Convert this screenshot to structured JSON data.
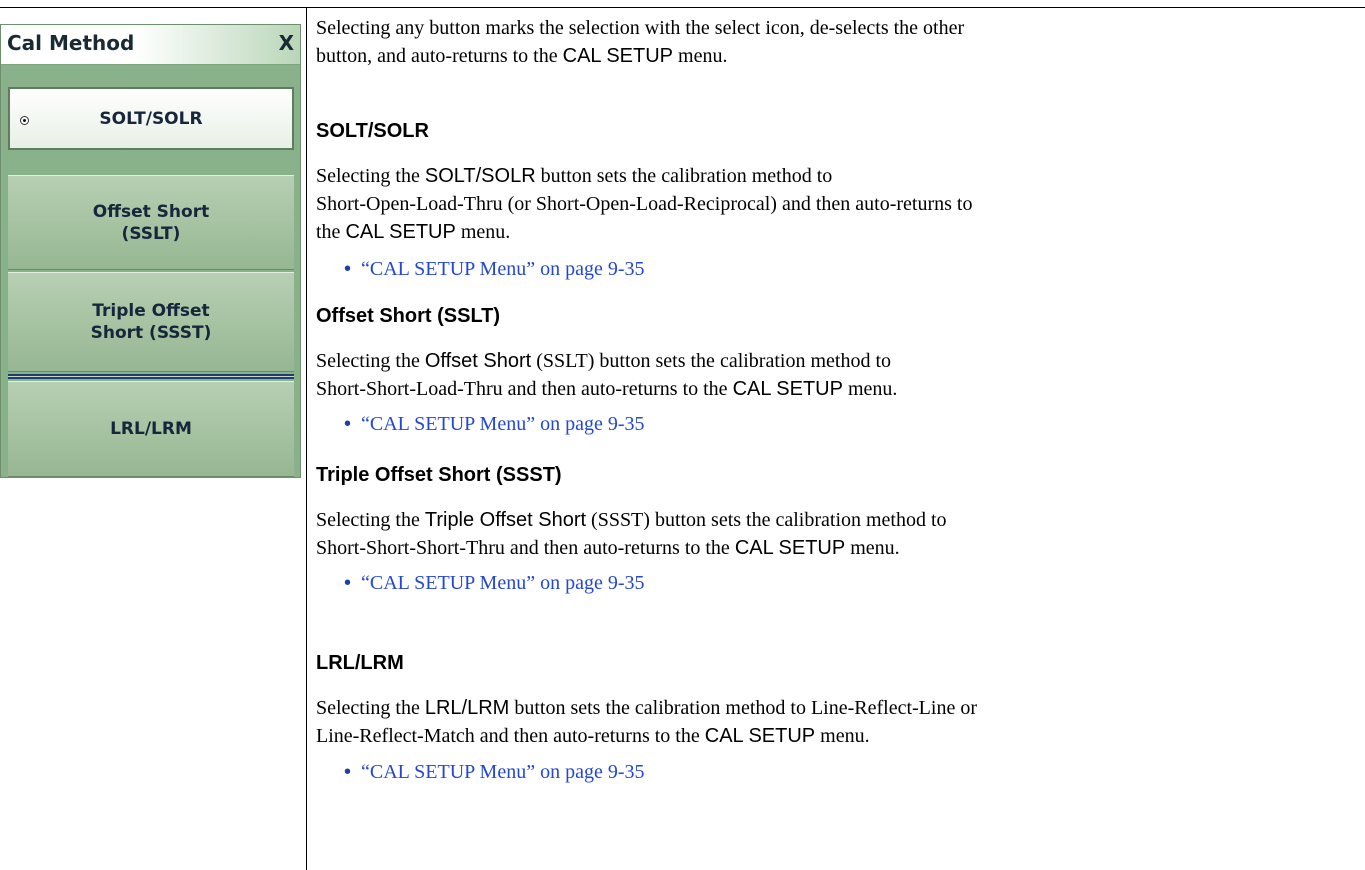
{
  "menu": {
    "title": "Cal Method",
    "close_label": "X",
    "buttons": [
      {
        "label": "SOLT/SOLR",
        "selected": true
      },
      {
        "label": "Offset Short\n(SSLT)",
        "selected": false
      },
      {
        "label": "Triple Offset\nShort (SSST)",
        "selected": false
      },
      {
        "label": "LRL/LRM",
        "selected": false
      }
    ]
  },
  "doc": {
    "intro": [
      "Selecting any button marks the selection with the select icon, de-selects the other",
      "button, and auto-returns to the ",
      "CAL SETUP",
      " menu."
    ],
    "sections": [
      {
        "heading": "SOLT/SOLR",
        "text_pre": "Selecting the ",
        "button_name": "SOLT/SOLR",
        "text_line1_post": " button sets the calibration method to",
        "text_line2": "Short-Open-Load-Thru (or Short-Open-Load-Reciprocal) and then auto-returns to",
        "text_line3_pre": "the ",
        "menu_name": "CAL SETUP",
        "text_line3_post": " menu.",
        "link": "“CAL SETUP Menu” on page 9-35"
      },
      {
        "heading": "Offset Short (SSLT)",
        "text_pre": "Selecting the ",
        "button_name": "Offset Short",
        "button_suffix": " (SSLT)",
        "text_line1_post": " button sets the calibration method to",
        "text_line2_pre": "Short-Short-Load-Thru and then auto-returns to the ",
        "menu_name": "CAL SETUP",
        "text_line2_post": " menu.",
        "link": "“CAL SETUP Menu” on page 9-35"
      },
      {
        "heading": "Triple Offset Short (SSST)",
        "text_pre": "Selecting the ",
        "button_name": "Triple Offset Short",
        "button_suffix": " (SSST)",
        "text_line1_post": " button sets the calibration method to",
        "text_line2_pre": "Short-Short-Short-Thru and then auto-returns to the ",
        "menu_name": "CAL SETUP",
        "text_line2_post": " menu.",
        "link": "“CAL SETUP Menu” on page 9-35"
      },
      {
        "heading": "LRL/LRM",
        "text_pre": "Selecting the ",
        "button_name": "LRL/LRM",
        "text_line1_post": " button sets the calibration method to Line-Reflect-Line or",
        "text_line2_pre": "Line-Reflect-Match and then auto-returns to the ",
        "menu_name": "CAL SETUP",
        "text_line2_post": " menu.",
        "link": "“CAL SETUP Menu” on page 9-35"
      }
    ]
  }
}
